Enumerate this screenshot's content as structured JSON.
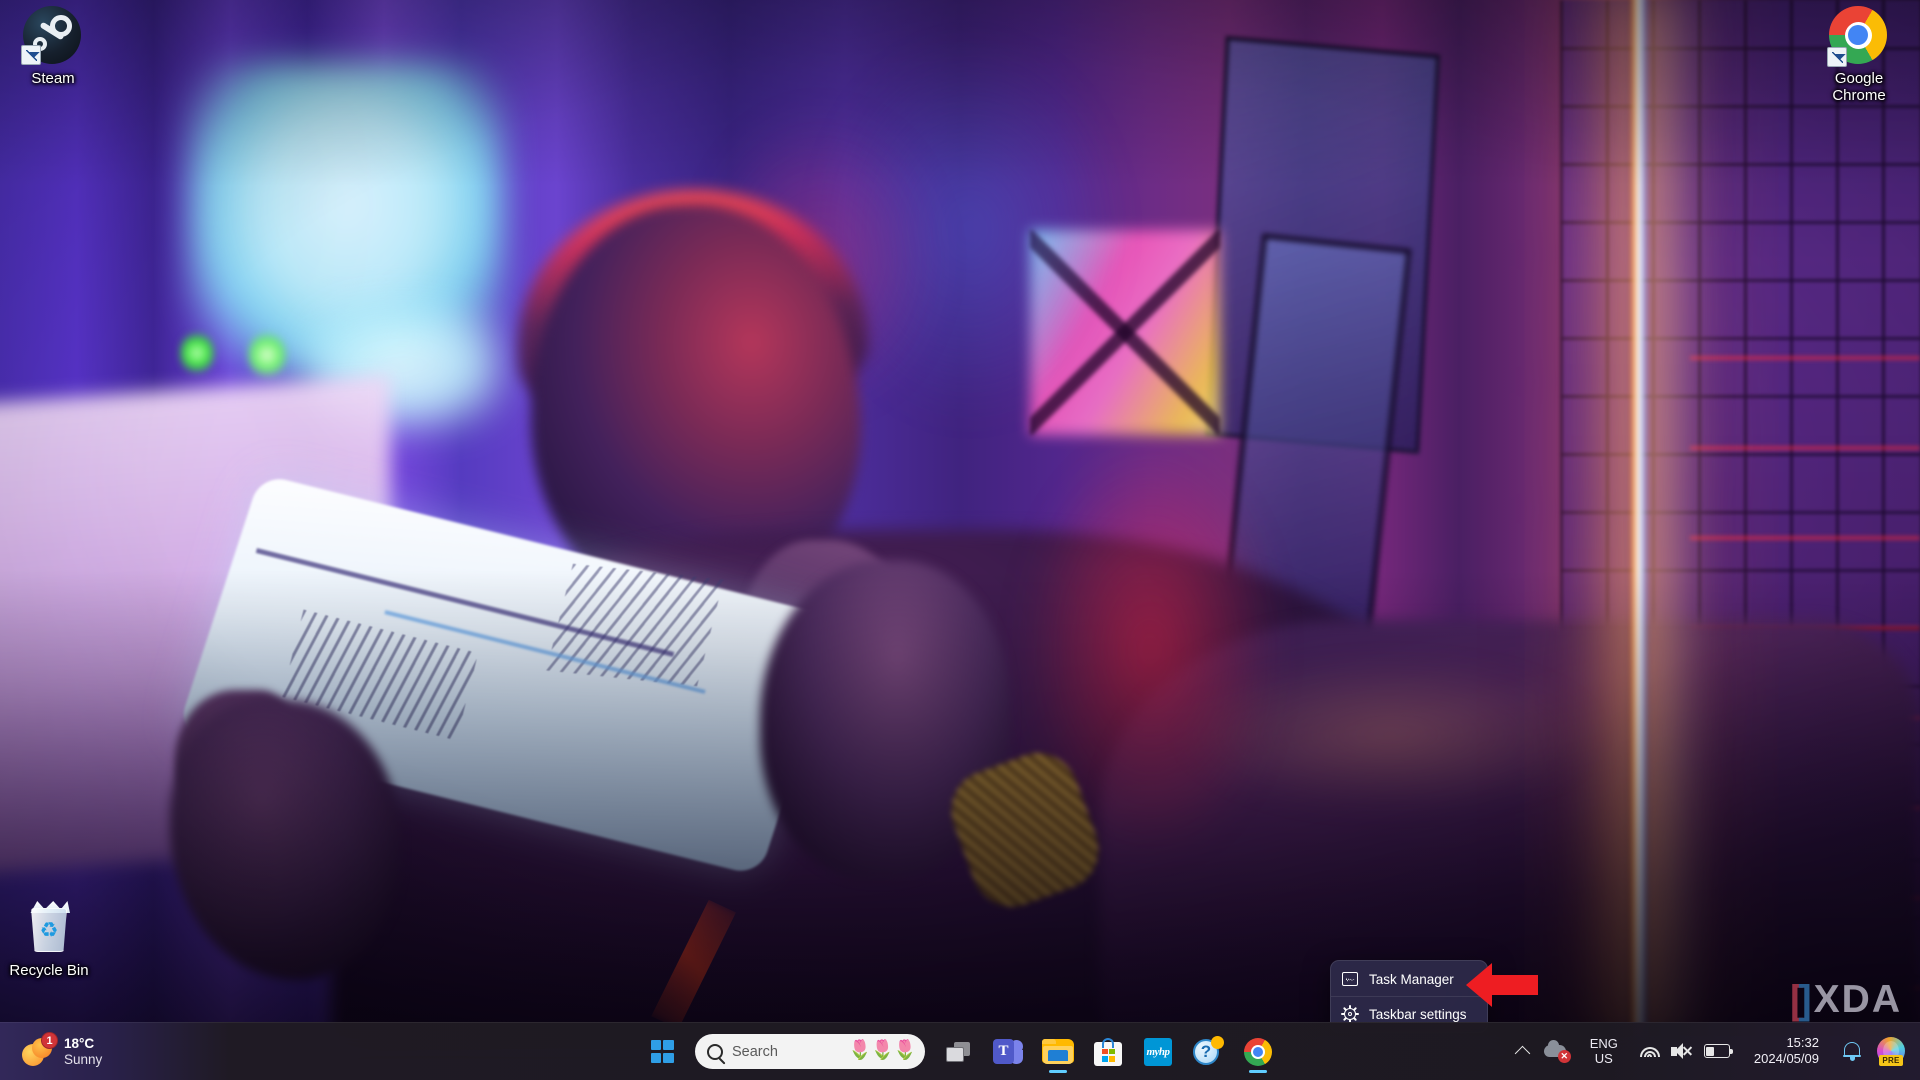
{
  "desktop": {
    "icons": [
      {
        "name": "steam",
        "label": "Steam",
        "icon": "steam-icon",
        "shortcut": true
      },
      {
        "name": "google-chrome",
        "label": "Google Chrome",
        "icon": "chrome-icon",
        "shortcut": true
      },
      {
        "name": "recycle-bin",
        "label": "Recycle Bin",
        "icon": "recycle-bin-icon",
        "shortcut": false
      }
    ],
    "watermark": {
      "bracket_left": "[",
      "bracket_right": "]",
      "word": "XDA"
    }
  },
  "taskbar": {
    "weather": {
      "temperature": "18°C",
      "condition": "Sunny",
      "badge_count": "1",
      "icon": "sun-icon"
    },
    "start_button": {
      "label": "Start",
      "icon": "windows-logo-icon"
    },
    "search": {
      "placeholder": "Search",
      "value": "",
      "icon": "search-icon",
      "decoration": "🌷🌷🌷"
    },
    "pinned": [
      {
        "name": "task-view",
        "label": "Task View",
        "icon": "task-view-icon",
        "running": false
      },
      {
        "name": "microsoft-teams",
        "label": "Microsoft Teams",
        "icon": "teams-icon",
        "running": false
      },
      {
        "name": "file-explorer",
        "label": "File Explorer",
        "icon": "folder-icon",
        "running": true
      },
      {
        "name": "microsoft-store",
        "label": "Microsoft Store",
        "icon": "store-icon",
        "running": false
      },
      {
        "name": "myhp",
        "label": "myHP",
        "icon": "myhp-icon",
        "running": false,
        "logo_text": "myhp"
      },
      {
        "name": "get-help",
        "label": "Get Help",
        "icon": "question-mark-icon",
        "running": false,
        "glyph": "?"
      },
      {
        "name": "google-chrome",
        "label": "Google Chrome",
        "icon": "chrome-icon",
        "running": true
      }
    ],
    "tray": {
      "overflow": {
        "label": "Show hidden icons",
        "icon": "chevron-up-icon"
      },
      "onedrive": {
        "label": "OneDrive — not signed in",
        "icon": "onedrive-icon",
        "error_glyph": "✕"
      },
      "language": {
        "line1": "ENG",
        "line2": "US",
        "icon": "input-indicator"
      },
      "network": {
        "label": "Wi-Fi",
        "icon": "wifi-icon"
      },
      "volume": {
        "label": "Volume muted",
        "icon": "speaker-muted-icon"
      },
      "battery": {
        "label": "Battery",
        "icon": "battery-icon"
      },
      "clock": {
        "time": "15:32",
        "date": "2024/05/09"
      },
      "notifications": {
        "label": "Notifications",
        "icon": "bell-icon"
      },
      "copilot": {
        "label": "Copilot",
        "icon": "copilot-icon",
        "badge": "PRE"
      }
    }
  },
  "context_menu": {
    "items": [
      {
        "name": "task-manager",
        "label": "Task Manager",
        "icon": "task-manager-icon"
      },
      {
        "name": "taskbar-settings",
        "label": "Taskbar settings",
        "icon": "gear-icon"
      }
    ]
  },
  "annotation": {
    "arrow": {
      "name": "red-arrow-pointer",
      "color": "#ee1d22",
      "direction": "left",
      "target": "Task Manager"
    }
  },
  "colors": {
    "accent": "#60cdff",
    "taskbar_bg": "#1f1b24",
    "menu_bg": "#2d2a4a",
    "badge_red": "#d13438",
    "annotation_red": "#ee1d22"
  }
}
